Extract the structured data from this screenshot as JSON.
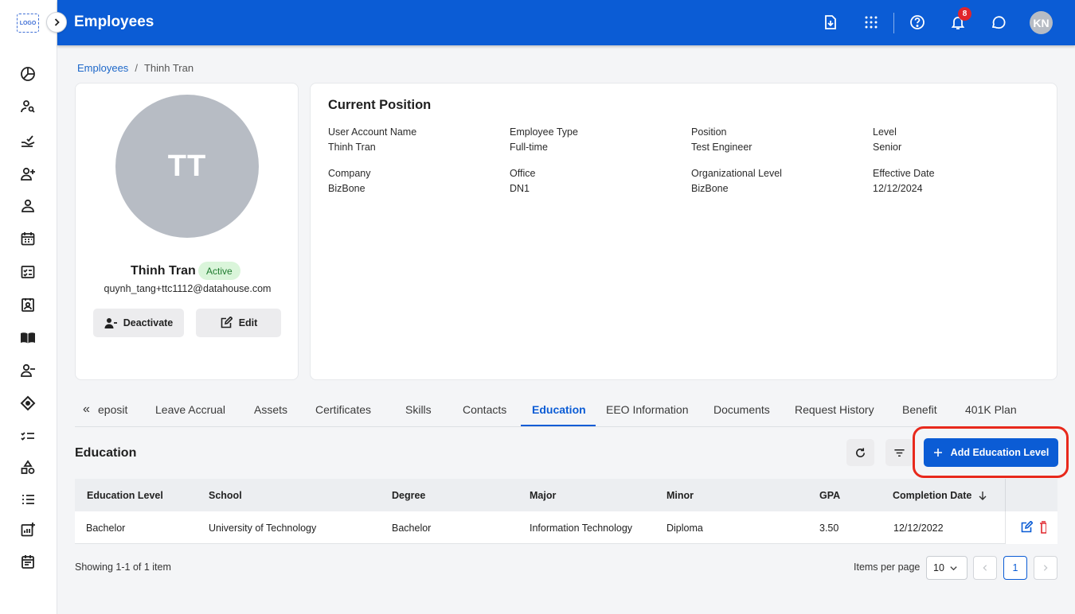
{
  "app": {
    "logo_text": "LOGO",
    "page_title": "Employees",
    "notifications_count": "8",
    "user_initials": "KN"
  },
  "breadcrumb": {
    "parent": "Employees",
    "separator": "/",
    "current": "Thinh Tran"
  },
  "profile": {
    "initials": "TT",
    "name": "Thinh Tran",
    "status": "Active",
    "email": "quynh_tang+ttc1112@datahouse.com",
    "deactivate_label": "Deactivate",
    "edit_label": "Edit"
  },
  "position": {
    "title": "Current Position",
    "fields": [
      {
        "label": "User Account Name",
        "value": "Thinh Tran"
      },
      {
        "label": "Employee Type",
        "value": "Full-time"
      },
      {
        "label": "Position",
        "value": "Test Engineer"
      },
      {
        "label": "Level",
        "value": "Senior"
      },
      {
        "label": "Company",
        "value": "BizBone"
      },
      {
        "label": "Office",
        "value": "DN1"
      },
      {
        "label": "Organizational Level",
        "value": "BizBone"
      },
      {
        "label": "Effective Date",
        "value": "12/12/2024"
      }
    ]
  },
  "tabs": {
    "scroll_glyph": "«",
    "items": [
      {
        "label": "eposit"
      },
      {
        "label": "Leave Accrual"
      },
      {
        "label": "Assets"
      },
      {
        "label": "Certificates"
      },
      {
        "label": "Skills"
      },
      {
        "label": "Contacts"
      },
      {
        "label": "Education"
      },
      {
        "label": "EEO Information"
      },
      {
        "label": "Documents"
      },
      {
        "label": "Request History"
      },
      {
        "label": "Benefit"
      },
      {
        "label": "401K Plan"
      }
    ],
    "active": "Education"
  },
  "education": {
    "title": "Education",
    "add_button_label": "Add Education Level",
    "columns": [
      "Education Level",
      "School",
      "Degree",
      "Major",
      "Minor",
      "GPA",
      "Completion Date"
    ],
    "rows": [
      [
        "Bachelor",
        "University of Technology",
        "Bachelor",
        "Information Technology",
        "Diploma",
        "3.50",
        "12/12/2022"
      ]
    ],
    "showing_text": "Showing 1-1 of 1 item",
    "items_per_page_label": "Items per page",
    "items_per_page_value": "10",
    "current_page": "1"
  },
  "colors": {
    "brand_blue": "#0b5cd5",
    "highlight_red": "#e8291c",
    "active_badge_bg": "#daf5da",
    "notification_red": "#e0252b"
  },
  "icons": {
    "sidebar": [
      "dashboard-icon",
      "user-search-icon",
      "approve-icon",
      "add-user-icon",
      "user-icon",
      "calendar-icon",
      "checklist-icon",
      "id-card-icon",
      "book-icon",
      "remove-user-icon",
      "tag-icon",
      "task-list-icon",
      "shapes-icon",
      "list-icon",
      "report-add-icon",
      "schedule-icon"
    ],
    "header": [
      "download-icon",
      "apps-grid-icon",
      "help-icon",
      "bell-icon",
      "chat-icon"
    ]
  }
}
